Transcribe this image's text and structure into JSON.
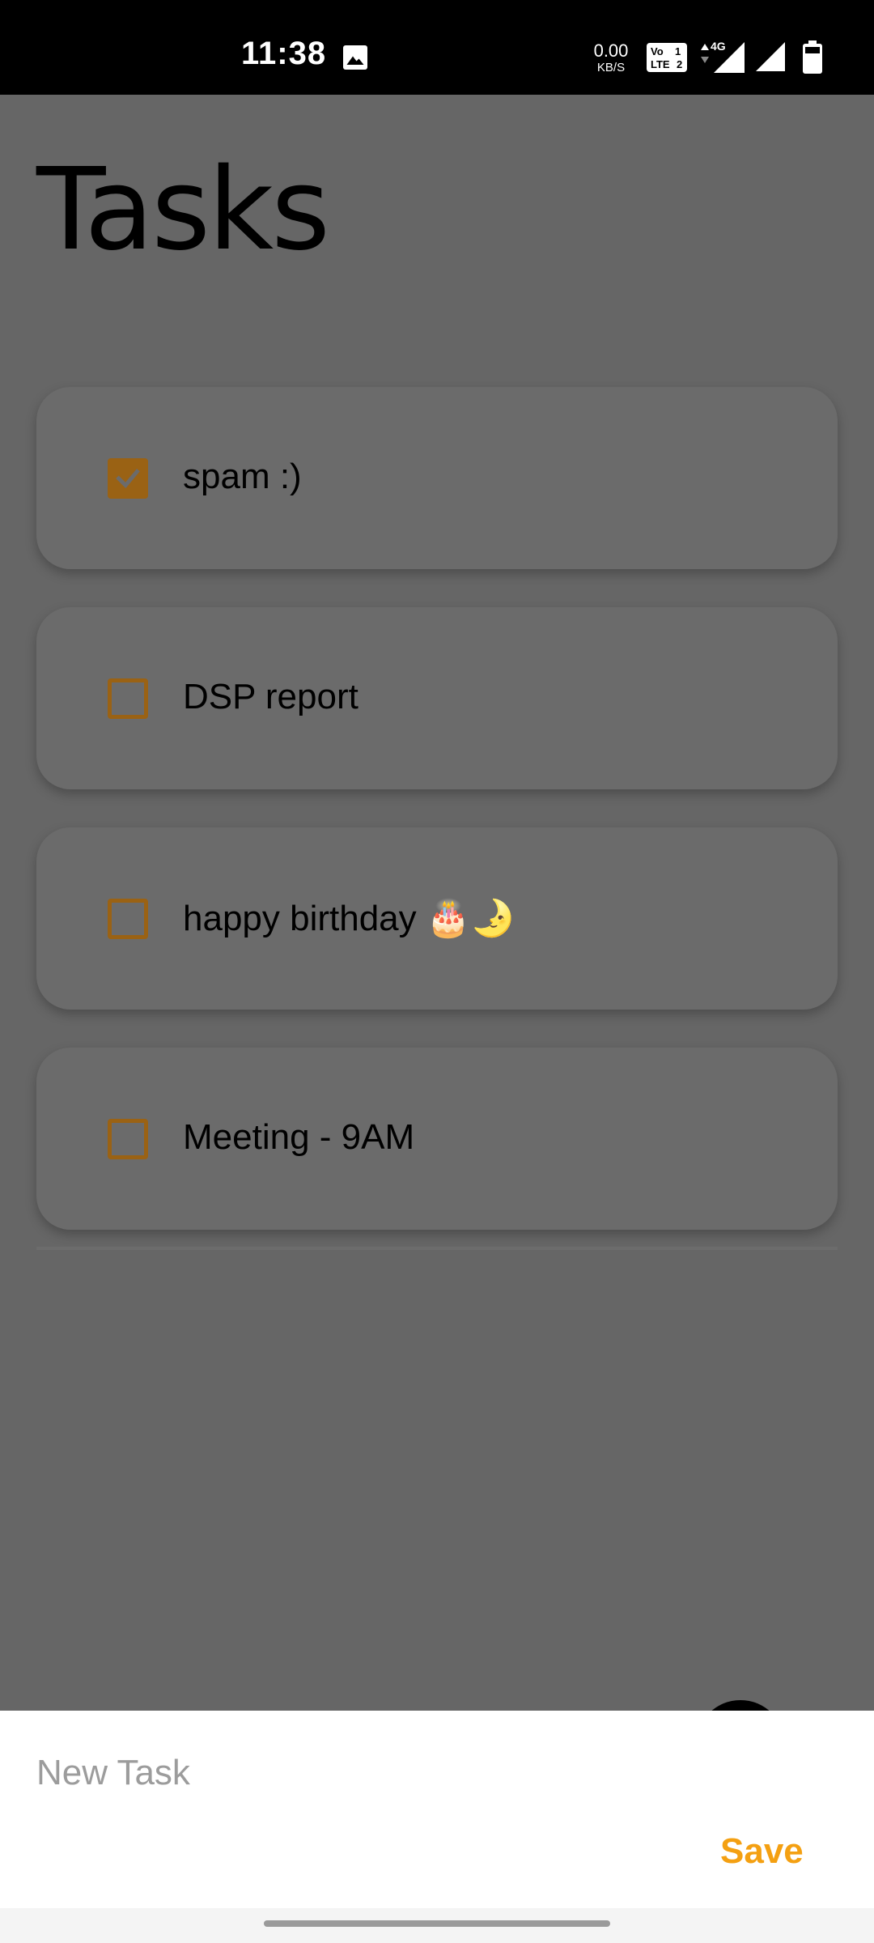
{
  "status_bar": {
    "time": "11:38",
    "net_speed_value": "0.00",
    "net_speed_unit": "KB/S",
    "volte_label": "Vo LTE 2",
    "network_type": "4G",
    "icons": [
      "gallery-icon",
      "volte-icon",
      "signal-icon",
      "signal-icon",
      "battery-icon"
    ]
  },
  "page": {
    "title": "Tasks"
  },
  "tasks": [
    {
      "label": "spam :)",
      "checked": true
    },
    {
      "label": "DSP report",
      "checked": false
    },
    {
      "label": "happy birthday 🎂🌛",
      "checked": false
    },
    {
      "label": "Meeting - 9AM",
      "checked": false
    }
  ],
  "new_task": {
    "placeholder": "New Task",
    "value": "",
    "save_label": "Save"
  },
  "colors": {
    "overlay": "#666666",
    "accent": "#f4a012",
    "checkbox_dimmed": "#9a6214"
  }
}
